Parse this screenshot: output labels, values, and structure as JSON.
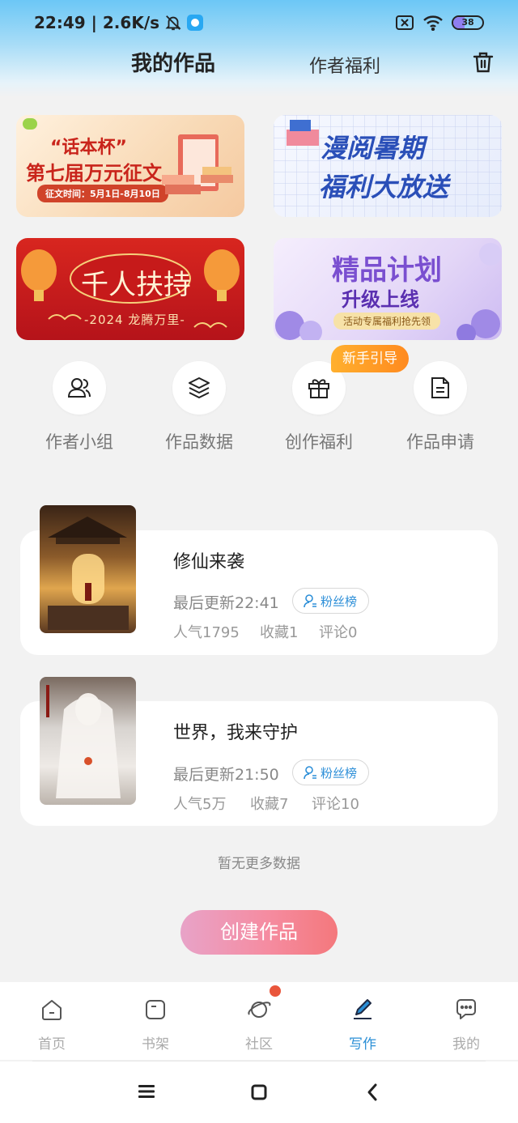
{
  "status_bar": {
    "time_speed": "22:49 | 2.6K/s",
    "battery_level": "38"
  },
  "header": {
    "tab_works": "我的作品",
    "tab_benefits": "作者福利"
  },
  "banners": [
    {
      "name": "contest-banner",
      "line1": "“话本杯”",
      "line2": "第七届万元征文",
      "line3": "征文时间：5月1日-8月10日"
    },
    {
      "name": "summer-benefit-banner",
      "line1": "漫阅暑期",
      "line2": "福利大放送"
    },
    {
      "name": "support-banner",
      "line1": "千人扶持",
      "line2": "-2024 龙腾万里-"
    },
    {
      "name": "quality-plan-banner",
      "line1": "精品计划",
      "line2": "升级上线",
      "line3": "活动专属福利抢先领"
    }
  ],
  "guide_tag": "新手引导",
  "quick_actions": [
    {
      "label": "作者小组",
      "icon": "users-icon"
    },
    {
      "label": "作品数据",
      "icon": "layers-icon"
    },
    {
      "label": "创作福利",
      "icon": "gift-icon"
    },
    {
      "label": "作品申请",
      "icon": "document-icon"
    }
  ],
  "works": [
    {
      "title": "修仙来袭",
      "update": "最后更新22:41",
      "fans_label": "粉丝榜",
      "popularity": "人气1795",
      "favorites": "收藏1",
      "comments": "评论0"
    },
    {
      "title": "世界，我来守护",
      "update": "最后更新21:50",
      "fans_label": "粉丝榜",
      "popularity": "人气5万",
      "favorites": "收藏7",
      "comments": "评论10"
    }
  ],
  "no_more_text": "暂无更多数据",
  "create_button": "创建作品",
  "bottom_nav": [
    {
      "label": "首页",
      "icon": "home-icon"
    },
    {
      "label": "书架",
      "icon": "bookshelf-icon"
    },
    {
      "label": "社区",
      "icon": "planet-icon"
    },
    {
      "label": "写作",
      "icon": "pen-icon",
      "active": true
    },
    {
      "label": "我的",
      "icon": "chat-bubble-icon"
    }
  ],
  "colors": {
    "accent": "#2b8fd6",
    "create_gradient_start": "#e8a3c8",
    "create_gradient_end": "#f4787c",
    "guide_tag": "#ff9a26",
    "notification_dot": "#e9553b"
  }
}
